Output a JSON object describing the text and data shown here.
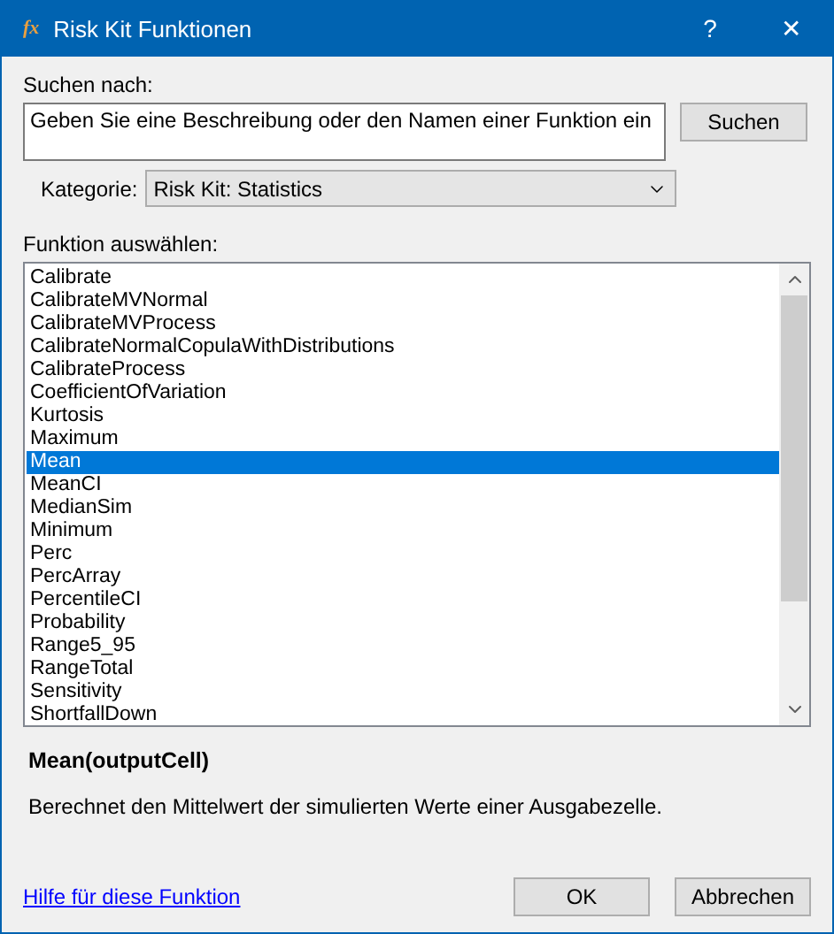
{
  "window": {
    "icon_text": "fx",
    "title": "Risk Kit Funktionen",
    "help": "?",
    "close": "✕"
  },
  "search": {
    "label": "Suchen nach:",
    "value": "Geben Sie eine Beschreibung oder den Namen einer Funktion ein",
    "button": "Suchen"
  },
  "category": {
    "label": "Kategorie:",
    "value": "Risk Kit: Statistics"
  },
  "function_list": {
    "label": "Funktion auswählen:",
    "items": [
      {
        "label": "Calibrate",
        "selected": false
      },
      {
        "label": "CalibrateMVNormal",
        "selected": false
      },
      {
        "label": "CalibrateMVProcess",
        "selected": false
      },
      {
        "label": "CalibrateNormalCopulaWithDistributions",
        "selected": false
      },
      {
        "label": "CalibrateProcess",
        "selected": false
      },
      {
        "label": "CoefficientOfVariation",
        "selected": false
      },
      {
        "label": "Kurtosis",
        "selected": false
      },
      {
        "label": "Maximum",
        "selected": false
      },
      {
        "label": "Mean",
        "selected": true
      },
      {
        "label": "MeanCI",
        "selected": false
      },
      {
        "label": "MedianSim",
        "selected": false
      },
      {
        "label": "Minimum",
        "selected": false
      },
      {
        "label": "Perc",
        "selected": false
      },
      {
        "label": "PercArray",
        "selected": false
      },
      {
        "label": "PercentileCI",
        "selected": false
      },
      {
        "label": "Probability",
        "selected": false
      },
      {
        "label": "Range5_95",
        "selected": false
      },
      {
        "label": "RangeTotal",
        "selected": false
      },
      {
        "label": "Sensitivity",
        "selected": false
      },
      {
        "label": "ShortfallDown",
        "selected": false
      }
    ]
  },
  "signature": "Mean(outputCell)",
  "description": "Berechnet den Mittelwert der simulierten Werte einer Ausgabezelle.",
  "help_link": "Hilfe für diese Funktion",
  "buttons": [
    "OK",
    "Abbrechen"
  ]
}
